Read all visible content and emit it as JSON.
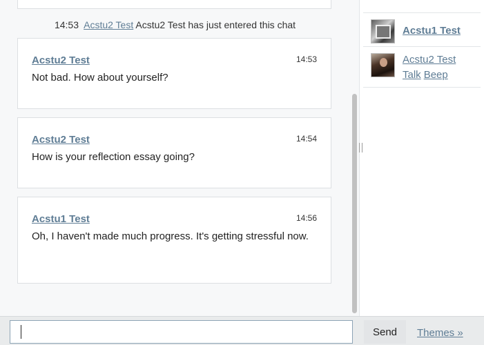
{
  "system_message": {
    "time": "14:53",
    "user": "Acstu2 Test",
    "text": "Acstu2 Test has just entered this chat"
  },
  "messages": [
    {
      "author": "Acstu2 Test",
      "time": "14:53",
      "text": "Not bad. How about yourself?"
    },
    {
      "author": "Acstu2 Test",
      "time": "14:54",
      "text": "How is your reflection essay going?"
    },
    {
      "author": "Acstu1 Test",
      "time": "14:56",
      "text": "Oh, I haven't made much progress. It's getting stressful now."
    }
  ],
  "users": [
    {
      "name": "Acstu1 Test",
      "avatar": "user-avatar-1"
    },
    {
      "name": "Acstu2 Test",
      "avatar": "user-avatar-2",
      "actions": [
        "Talk",
        "Beep"
      ]
    }
  ],
  "composer": {
    "input_value": "",
    "send_label": "Send",
    "themes_label": "Themes »"
  }
}
